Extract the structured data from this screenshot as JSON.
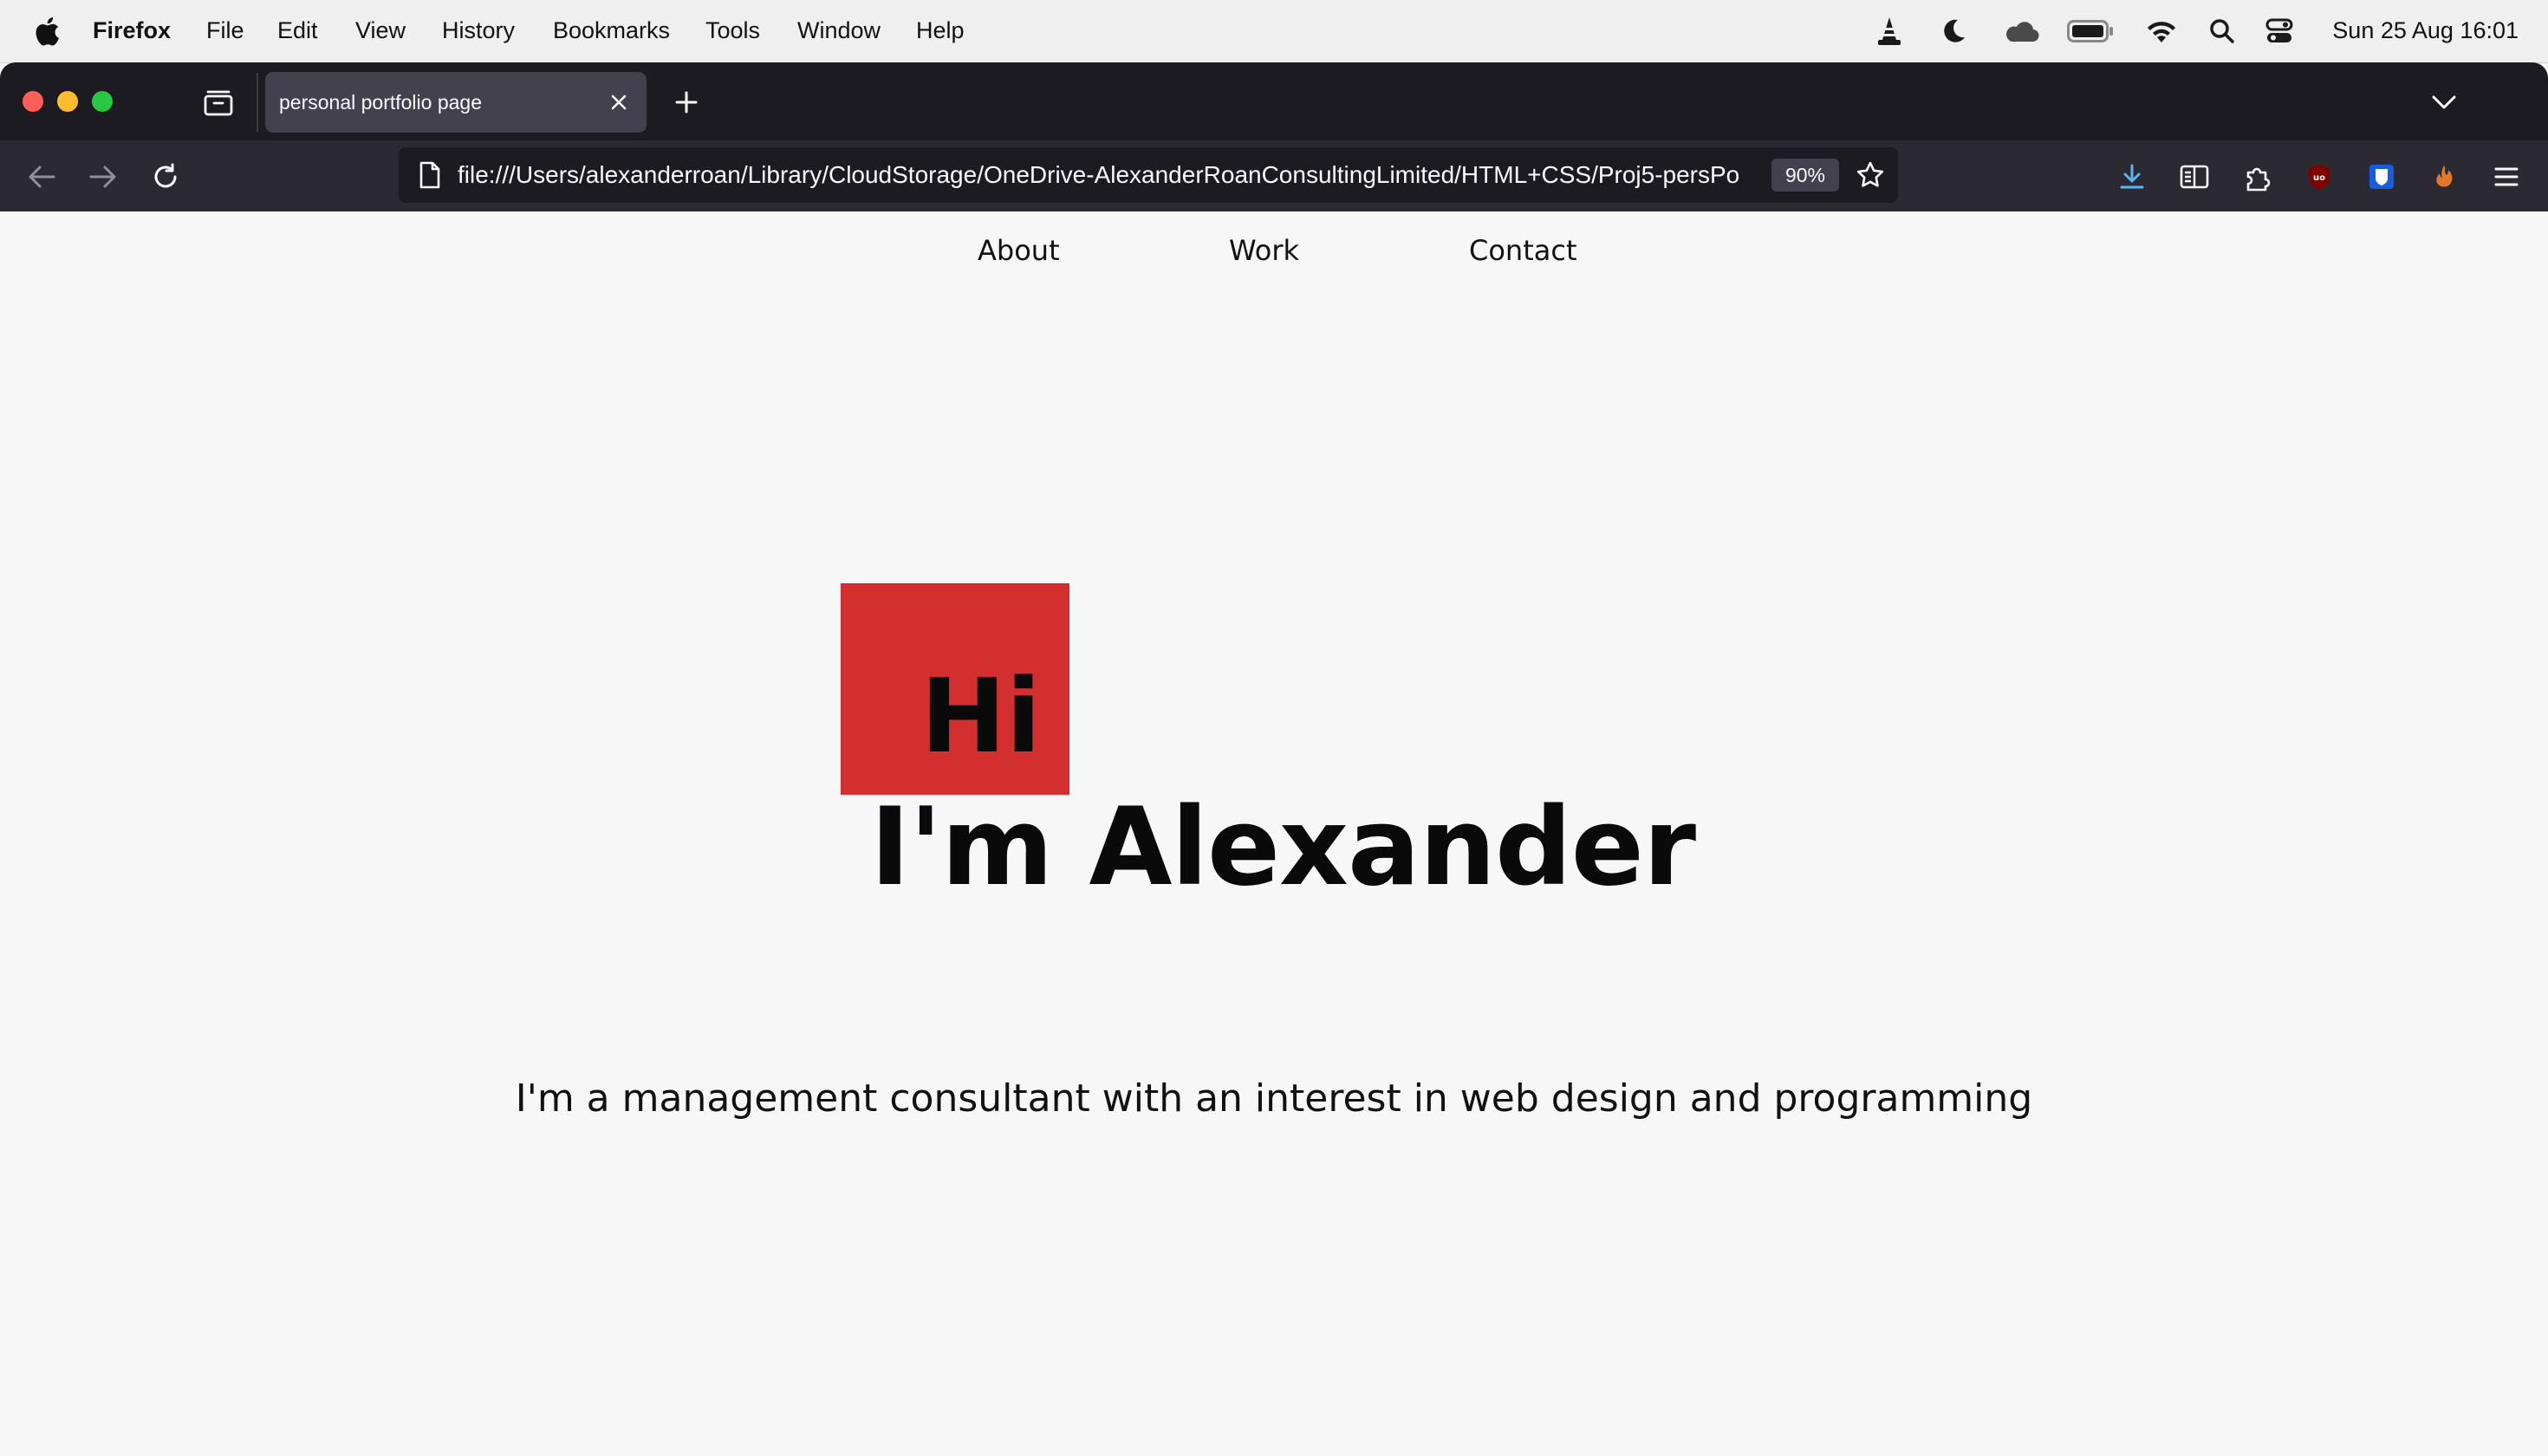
{
  "menubar": {
    "apple_icon": "apple-logo",
    "items": [
      "Firefox",
      "File",
      "Edit",
      "View",
      "History",
      "Bookmarks",
      "Tools",
      "Window",
      "Help"
    ],
    "status_icons": [
      "vlc-cone-icon",
      "moon-icon",
      "cloud-icon",
      "battery-icon",
      "wifi-icon",
      "search-icon",
      "control-center-icon"
    ],
    "clock": "Sun 25 Aug  16:01"
  },
  "browser": {
    "tab": {
      "title": "personal portfolio page"
    },
    "url": "file:///Users/alexanderroan/Library/CloudStorage/OneDrive-AlexanderRoanConsultingLimited/HTML+CSS/Proj5-persPo",
    "zoom": "90%",
    "toolbar_icons": [
      "download-icon",
      "reader-view-icon",
      "extensions-icon",
      "ublock-icon",
      "bitwarden-icon",
      "extension-icon"
    ]
  },
  "page": {
    "nav": [
      "About",
      "Work",
      "Contact"
    ],
    "hero": {
      "hi": "Hi",
      "name": "I'm Alexander",
      "tagline": "I'm a management consultant with an interest in web design and programming"
    }
  },
  "colors": {
    "accent_red": "#d42f2f",
    "page_bg": "#f7f7f7",
    "chrome_dark": "#1c1b22",
    "toolbar": "#2b2a33"
  }
}
